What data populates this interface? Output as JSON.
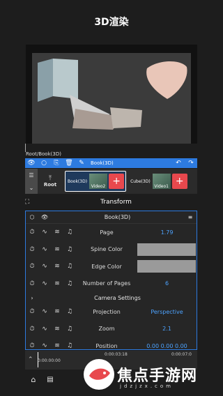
{
  "header": {
    "title": "3D渲染"
  },
  "breadcrumb": "Root/Book(3D)",
  "toolbar": {
    "title": "Book(3D)"
  },
  "layers": {
    "root_label": "Root",
    "items": [
      {
        "name": "Book(3D)",
        "thumb": "Video2"
      },
      {
        "name": "Cube(3D)",
        "thumb": "Video1"
      }
    ]
  },
  "transform": {
    "title": "Transform"
  },
  "panel": {
    "title": "Book(3D)",
    "rows": [
      {
        "label": "Page",
        "value": "1.79"
      },
      {
        "label": "Spine Color",
        "value": ""
      },
      {
        "label": "Edge Color",
        "value": ""
      },
      {
        "label": "Number of Pages",
        "value": "6"
      }
    ],
    "section": "Camera Settings",
    "camera_rows": [
      {
        "label": "Projection",
        "value": "Perspective"
      },
      {
        "label": "Zoom",
        "value": "2.1"
      },
      {
        "label": "Position",
        "value": "0.00  0.00  0.00"
      }
    ]
  },
  "timeline": {
    "start": "0:00:00:00",
    "t1": "0:00:03:18",
    "t2": "0:00:07:0"
  },
  "watermark": {
    "text": "焦点手游网",
    "sub": "jdzjzx.com"
  },
  "colors": {
    "accent": "#2d7be0",
    "add": "#e8484d",
    "value": "#4da3ff"
  }
}
